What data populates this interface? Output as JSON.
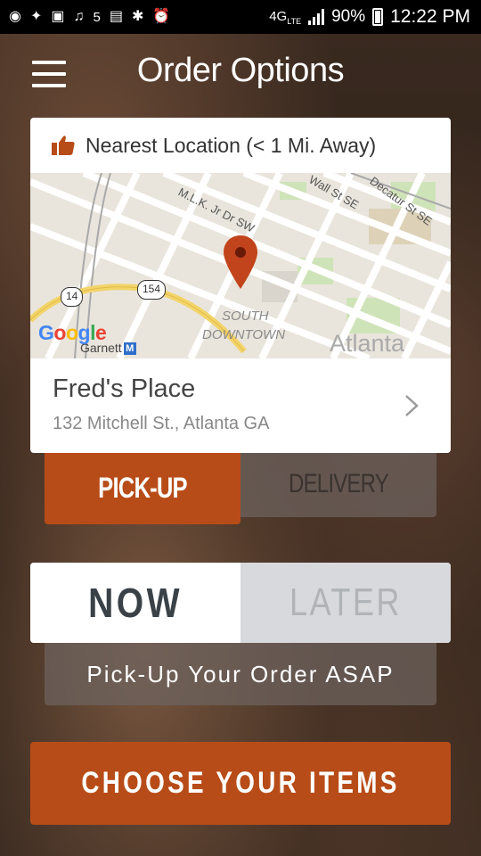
{
  "status_bar": {
    "notification_icons": [
      "chat-bubble-icon",
      "twitter-icon",
      "news-app-icon",
      "music-note-icon",
      "fox-5-icon",
      "gallery-icon",
      "bluetooth-icon",
      "alarm-icon"
    ],
    "fox_label": "5",
    "network": "4G",
    "network_sub": "LTE",
    "battery": "90%",
    "time": "12:22 PM"
  },
  "header": {
    "title": "Order Options"
  },
  "location": {
    "heading": "Nearest Location (< 1 Mi. Away)",
    "name": "Fred's Place",
    "address": "132 Mitchell St., Atlanta GA",
    "accent_color": "#b84c18"
  },
  "map": {
    "streets": [
      "M.L.K. Jr Dr SW",
      "Wall St SE",
      "Decatur St SE"
    ],
    "shields": [
      "14",
      "154"
    ],
    "district_line1": "SOUTH",
    "district_line2": "DOWNTOWN",
    "city": "Atlanta",
    "station": "Garnett",
    "station_badge": "M",
    "logo": "Google"
  },
  "order_type": {
    "selected": "PICK-UP",
    "options": [
      "PICK-UP",
      "DELIVERY"
    ]
  },
  "timing": {
    "selected": "NOW",
    "options": [
      "NOW",
      "LATER"
    ],
    "description": "Pick-Up Your Order ASAP"
  },
  "cta": {
    "label": "CHOOSE YOUR ITEMS",
    "color": "#b84c18"
  }
}
